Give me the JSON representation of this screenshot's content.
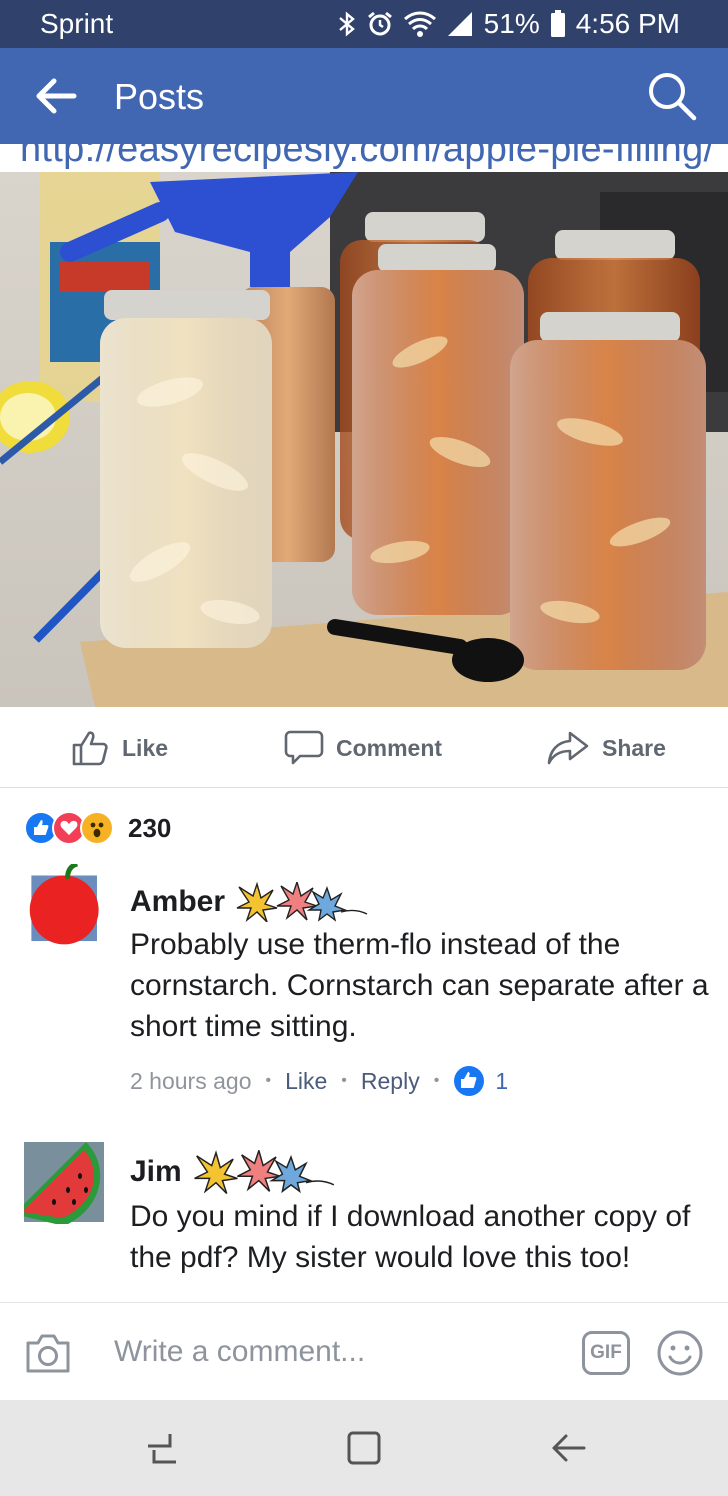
{
  "status_bar": {
    "carrier": "Sprint",
    "battery": "51%",
    "time": "4:56 PM",
    "icons": [
      "bluetooth-icon",
      "alarm-icon",
      "wifi-icon",
      "signal-icon",
      "battery-icon"
    ]
  },
  "app_bar": {
    "title": "Posts",
    "back_icon": "arrow-left-icon",
    "search_icon": "search-icon",
    "color": "#4267b2"
  },
  "post": {
    "link_text": "http://easyrecipesly.com/apple-pie-filling/",
    "image_alt": "jars of apple pie filling"
  },
  "actions": {
    "like": "Like",
    "comment": "Comment",
    "share": "Share"
  },
  "reactions": {
    "icons": [
      "like-reaction-icon",
      "love-reaction-icon",
      "wow-reaction-icon"
    ],
    "count": "230"
  },
  "comments": [
    {
      "name": "Amber",
      "avatar": "apple-avatar",
      "text": "Probably use therm-flo instead of the cornstarch. Cornstarch can separate after a short time sitting.",
      "time": "2 hours ago",
      "like_label": "Like",
      "reply_label": "Reply",
      "like_count": "1"
    },
    {
      "name": "Jim",
      "avatar": "watermelon-avatar",
      "text": "Do you mind if I download another copy of the pdf? My sister would love this too!"
    }
  ],
  "composer": {
    "placeholder": "Write a comment...",
    "gif_label": "GIF",
    "camera_icon": "camera-icon",
    "emoji_icon": "smiley-icon"
  },
  "nav_bar": {
    "icons": [
      "recent-apps-icon",
      "home-icon",
      "back-icon"
    ]
  }
}
